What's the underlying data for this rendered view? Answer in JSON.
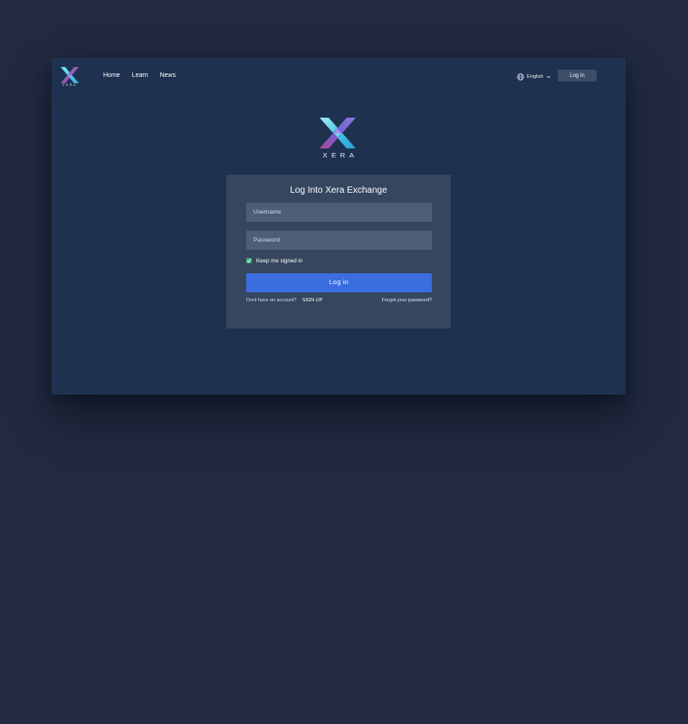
{
  "header": {
    "logo_text": "XERA",
    "nav": [
      {
        "label": "Home"
      },
      {
        "label": "Learn"
      },
      {
        "label": "News"
      }
    ],
    "language": {
      "label": "English",
      "icon": "globe-icon"
    },
    "login_label": "Log in"
  },
  "brand": {
    "wordmark": "XERA"
  },
  "login_card": {
    "title": "Log Into Xera Exchange",
    "username_placeholder": "Username",
    "password_placeholder": "Password",
    "keep_signed_in_label": "Keep me signed in",
    "keep_signed_in_checked": true,
    "submit_label": "Log in",
    "no_account_text": "Dont have an account?",
    "signup_label": "SIGN UP",
    "forgot_label": "Forgot your password?"
  },
  "colors": {
    "page_background": "#212a40",
    "app_background": "#1e3250",
    "card_background": "#35465f",
    "input_background": "#4d5e78",
    "primary_button": "#3a6ee0",
    "checkbox": "#3fae7a",
    "logo_gradient": [
      "#3fc4e8",
      "#6a63d8",
      "#b24da8"
    ]
  }
}
